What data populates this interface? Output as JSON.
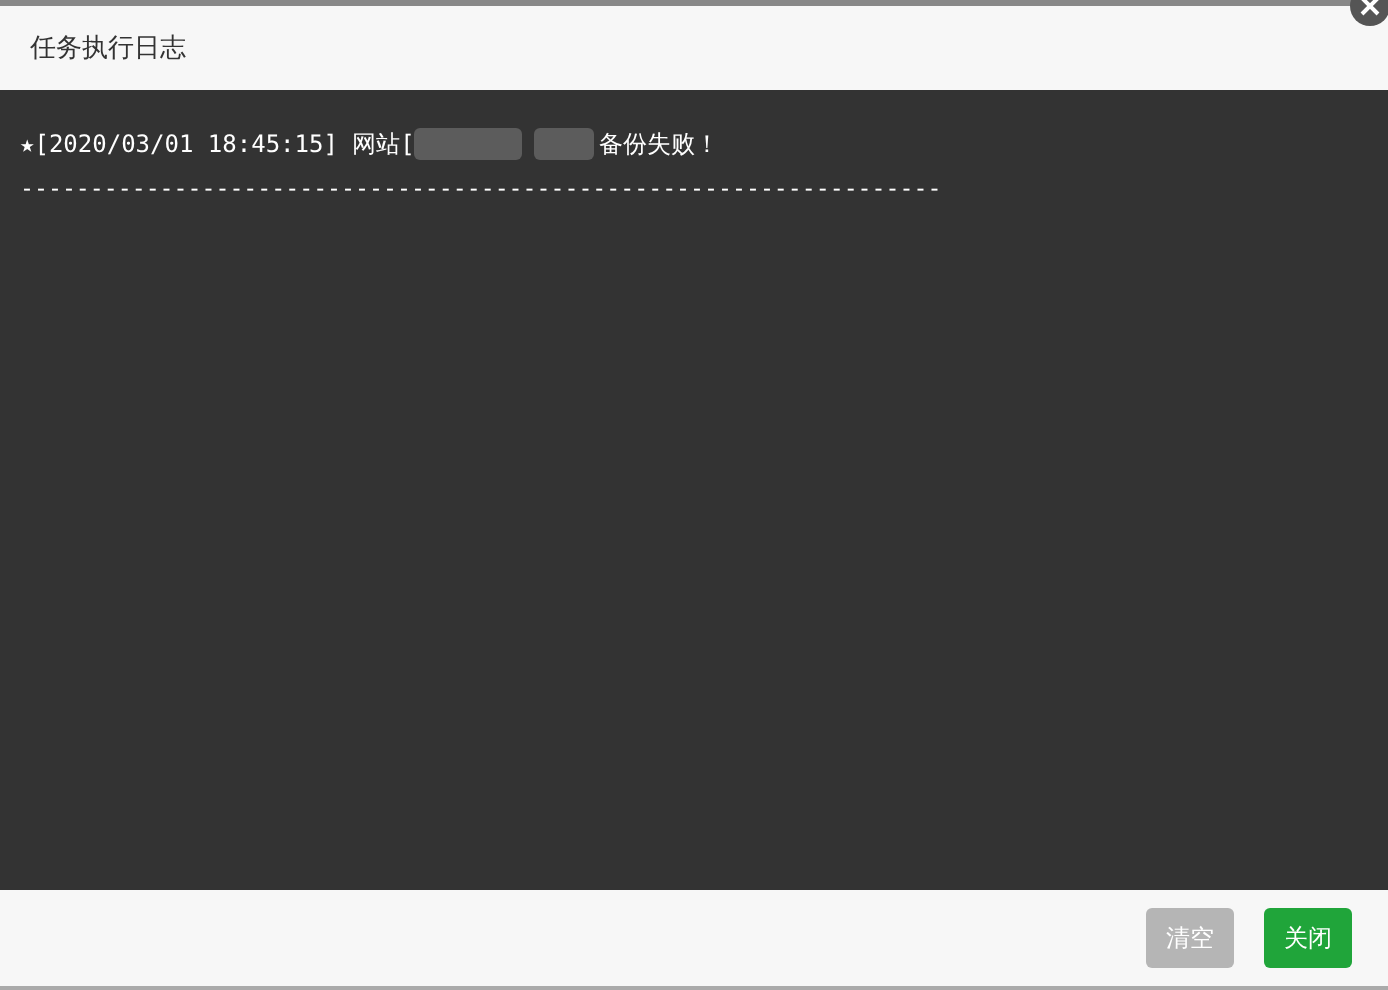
{
  "dialog": {
    "title": "任务执行日志"
  },
  "log": {
    "entries": [
      {
        "prefix": "★[2020/03/01 18:45:15] 网站[",
        "suffix": "备份失败！"
      }
    ],
    "separator": "------------------------------------------------------------------"
  },
  "buttons": [
    {
      "label": "清空",
      "kind": "secondary",
      "disabled": true
    },
    {
      "label": "关闭",
      "kind": "primary",
      "disabled": false
    }
  ]
}
